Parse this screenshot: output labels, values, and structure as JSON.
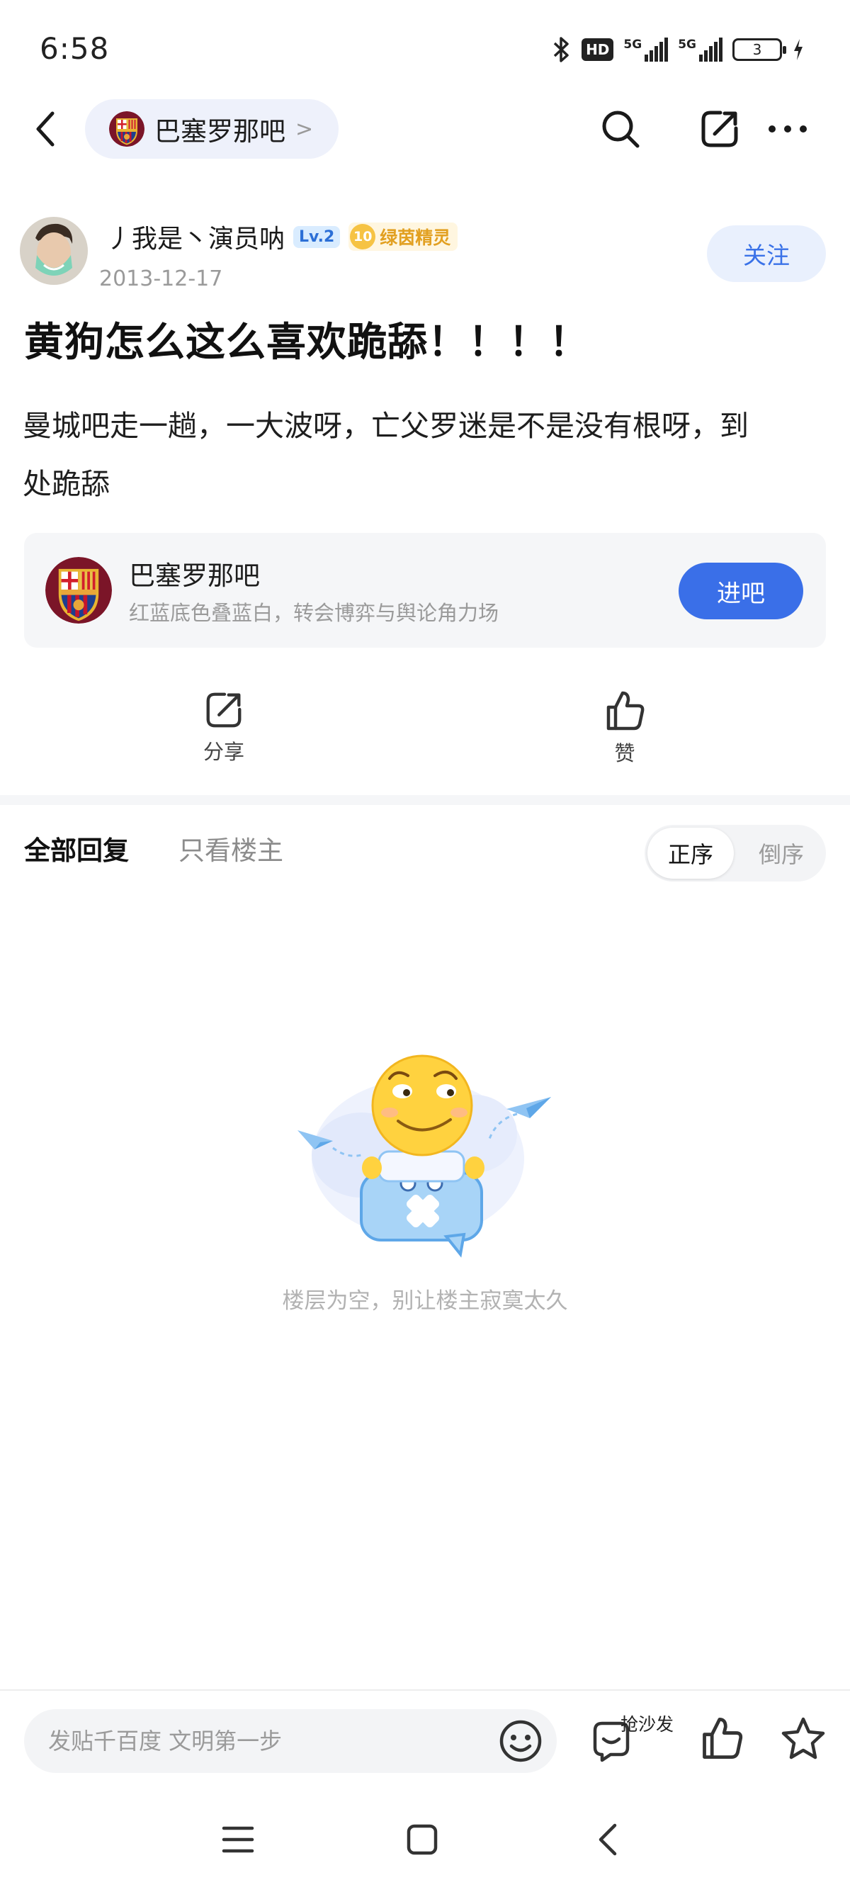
{
  "status_bar": {
    "time": "6:58",
    "hd_label": "HD",
    "net1_label": "5G",
    "net2_label": "5G",
    "battery_level": "3"
  },
  "nav": {
    "forum_name": "巴塞罗那吧",
    "chevron": ">"
  },
  "post": {
    "author_name": "丿我是丶演员呐",
    "level_badge": "Lv.2",
    "title_level": "10",
    "title_badge": "绿茵精灵",
    "date": "2013-12-17",
    "follow_label": "关注",
    "title": "黄狗怎么这么喜欢跪舔！！！！",
    "body_line1": "曼城吧走一趟，一大波呀，亡父罗迷是不是没有根呀，到",
    "body_line2": "处跪舔"
  },
  "forum_card": {
    "name": "巴塞罗那吧",
    "description": "红蓝底色叠蓝白，转会博弈与舆论角力场",
    "enter_label": "进吧"
  },
  "actions": {
    "share_label": "分享",
    "like_label": "赞"
  },
  "replies": {
    "tab_all": "全部回复",
    "tab_op_only": "只看楼主",
    "sort_asc": "正序",
    "sort_desc": "倒序",
    "empty_text": "楼层为空，别让楼主寂寞太久"
  },
  "bottom_bar": {
    "input_placeholder": "发贴千百度 文明第一步",
    "sofa_label": "抢沙发"
  },
  "colors": {
    "accent": "#3a6fe8",
    "follow_bg": "#e9f0fd",
    "card_bg": "#f5f6f8"
  }
}
